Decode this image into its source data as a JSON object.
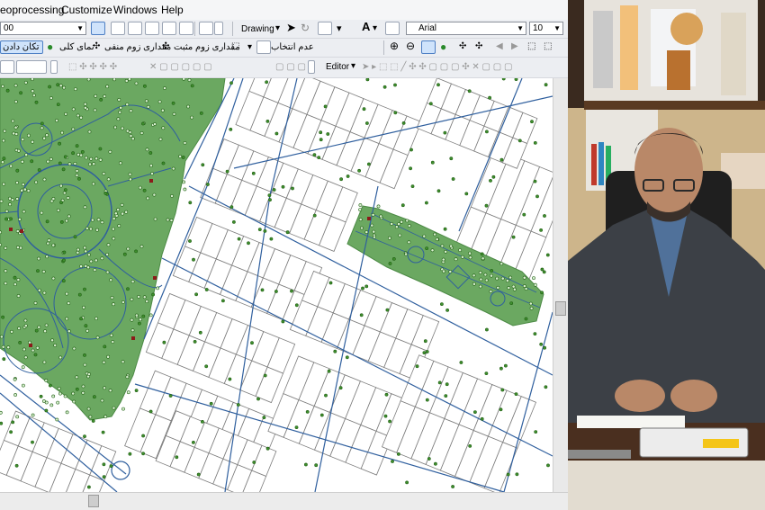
{
  "menu": {
    "geoprocessing": "eoprocessing",
    "customize": "Customize",
    "windows": "Windows",
    "help": "Help"
  },
  "toolbar_standard": {
    "scale_value": "00",
    "drawing_label": "Drawing",
    "font_name": "Arial",
    "font_size": "10"
  },
  "toolbar_tools": {
    "pan_label": "تکان دادن",
    "full_extent_label": "نمای کلی",
    "fixed_zoom_in_label": "مقداری زوم منفی",
    "fixed_zoom_out_label": "مقداری زوم مثبت",
    "clear_selection_label": "عدم انتخاب"
  },
  "toolbar_editor": {
    "editor_label": "Editor"
  },
  "colors": {
    "park_fill": "#6ba861",
    "park_stroke": "#4c8a45",
    "street_line": "#2f5f9e",
    "parcel_line": "#7d7d7d",
    "tree_point": "#2d7a1f",
    "marker_red": "#8b1a1a"
  }
}
